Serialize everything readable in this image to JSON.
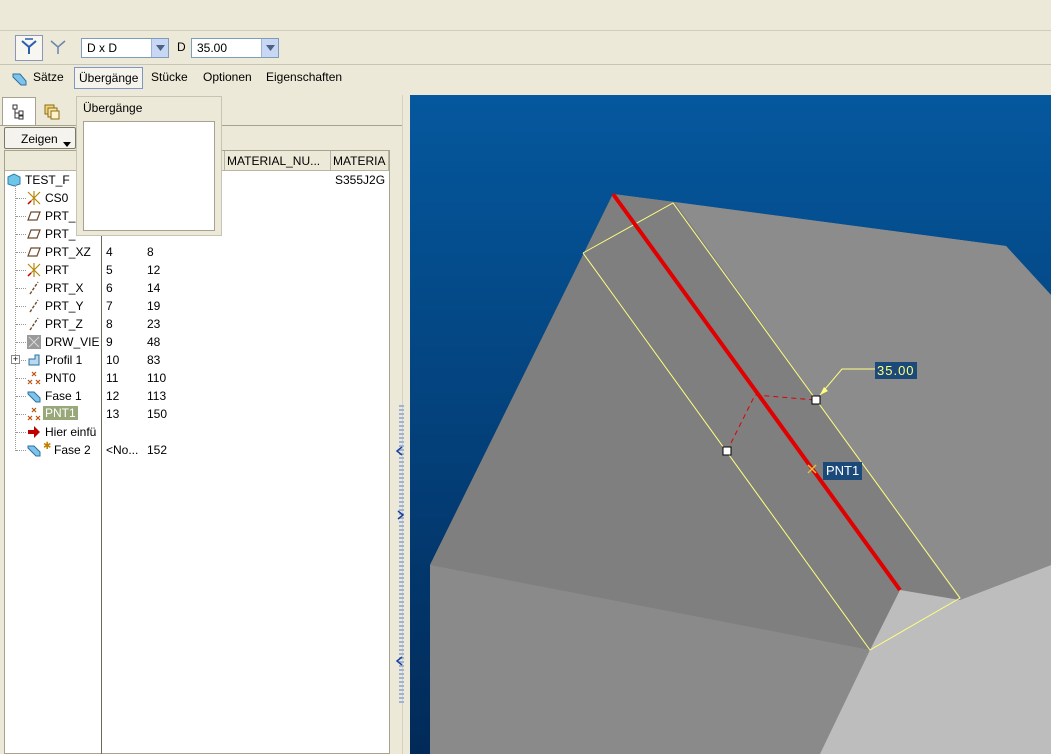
{
  "dashboard": {
    "scheme_value": "D x D",
    "d_label": "D",
    "d_value": "35.00"
  },
  "menu": {
    "items": [
      "Sätze",
      "Übergänge",
      "Stücke",
      "Optionen",
      "Eigenschaften"
    ]
  },
  "popup": {
    "title": "Übergänge"
  },
  "left_panel": {
    "show_button": "Zeigen",
    "columns": [
      "MATERIAL_NU...",
      "MATERIA"
    ],
    "root": {
      "name": "TEST_F",
      "material": "S355J2G"
    },
    "rows": [
      {
        "name": "CS0",
        "c1": "",
        "c2": "",
        "icon": "coordinate-system-icon"
      },
      {
        "name": "PRT_",
        "c1": "",
        "c2": "",
        "icon": "datum-plane-icon"
      },
      {
        "name": "PRT_",
        "c1": "",
        "c2": "",
        "icon": "datum-plane-icon"
      },
      {
        "name": "PRT_XZ",
        "c1": "4",
        "c2": "8",
        "icon": "datum-plane-icon"
      },
      {
        "name": "PRT",
        "c1": "5",
        "c2": "12",
        "icon": "coordinate-system-icon"
      },
      {
        "name": "PRT_X",
        "c1": "6",
        "c2": "14",
        "icon": "datum-axis-icon"
      },
      {
        "name": "PRT_Y",
        "c1": "7",
        "c2": "19",
        "icon": "datum-axis-icon"
      },
      {
        "name": "PRT_Z",
        "c1": "8",
        "c2": "23",
        "icon": "datum-axis-icon"
      },
      {
        "name": "DRW_VIE",
        "c1": "9",
        "c2": "48",
        "icon": "drawing-view-icon"
      },
      {
        "name": "Profil 1",
        "c1": "10",
        "c2": "83",
        "icon": "profile-icon"
      },
      {
        "name": "PNT0",
        "c1": "11",
        "c2": "110",
        "icon": "datum-point-icon"
      },
      {
        "name": "Fase 1",
        "c1": "12",
        "c2": "113",
        "icon": "chamfer-icon"
      },
      {
        "name": "PNT1",
        "c1": "13",
        "c2": "150",
        "icon": "datum-point-icon"
      },
      {
        "name": "Hier einfü",
        "c1": "",
        "c2": "",
        "icon": "insert-here-arrow-icon"
      },
      {
        "name": "Fase 2",
        "c1": "<No...",
        "c2": "152",
        "icon": "chamfer-icon"
      }
    ]
  },
  "viewport": {
    "dimension_label": "35.00",
    "point_label": "PNT1"
  },
  "colors": {
    "viewport_bg": "#05589e",
    "edge_highlight": "#e00000",
    "preview_outline": "#ffff80"
  }
}
